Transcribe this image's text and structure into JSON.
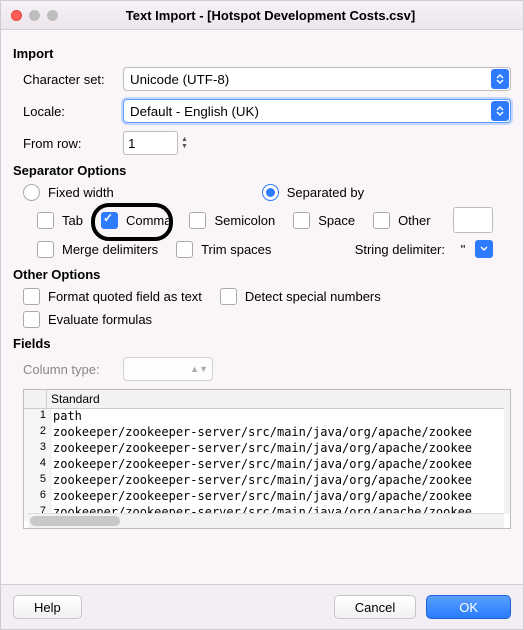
{
  "window": {
    "title": "Text Import - [Hotspot Development Costs.csv]"
  },
  "sections": {
    "import": "Import",
    "separator": "Separator Options",
    "other": "Other Options",
    "fields": "Fields"
  },
  "import": {
    "charset_label": "Character set:",
    "charset_value": "Unicode (UTF-8)",
    "locale_label": "Locale:",
    "locale_value": "Default - English (UK)",
    "from_row_label": "From row:",
    "from_row_value": "1"
  },
  "separator": {
    "fixed_width": "Fixed width",
    "separated_by": "Separated by",
    "tab": "Tab",
    "comma": "Comma",
    "semicolon": "Semicolon",
    "space": "Space",
    "other": "Other",
    "merge": "Merge delimiters",
    "trim": "Trim spaces",
    "string_delim_label": "String delimiter:",
    "string_delim_value": "\""
  },
  "other": {
    "format_quoted": "Format quoted field as text",
    "detect_special": "Detect special numbers",
    "evaluate_formulas": "Evaluate formulas"
  },
  "fields": {
    "column_type_label": "Column type:",
    "header": "Standard",
    "rows": [
      "path",
      "zookeeper/zookeeper-server/src/main/java/org/apache/zookee",
      "zookeeper/zookeeper-server/src/main/java/org/apache/zookee",
      "zookeeper/zookeeper-server/src/main/java/org/apache/zookee",
      "zookeeper/zookeeper-server/src/main/java/org/apache/zookee",
      "zookeeper/zookeeper-server/src/main/java/org/apache/zookee",
      "zookeeper/zookeeper-server/src/main/java/org/apache/zookee"
    ]
  },
  "buttons": {
    "help": "Help",
    "cancel": "Cancel",
    "ok": "OK"
  }
}
